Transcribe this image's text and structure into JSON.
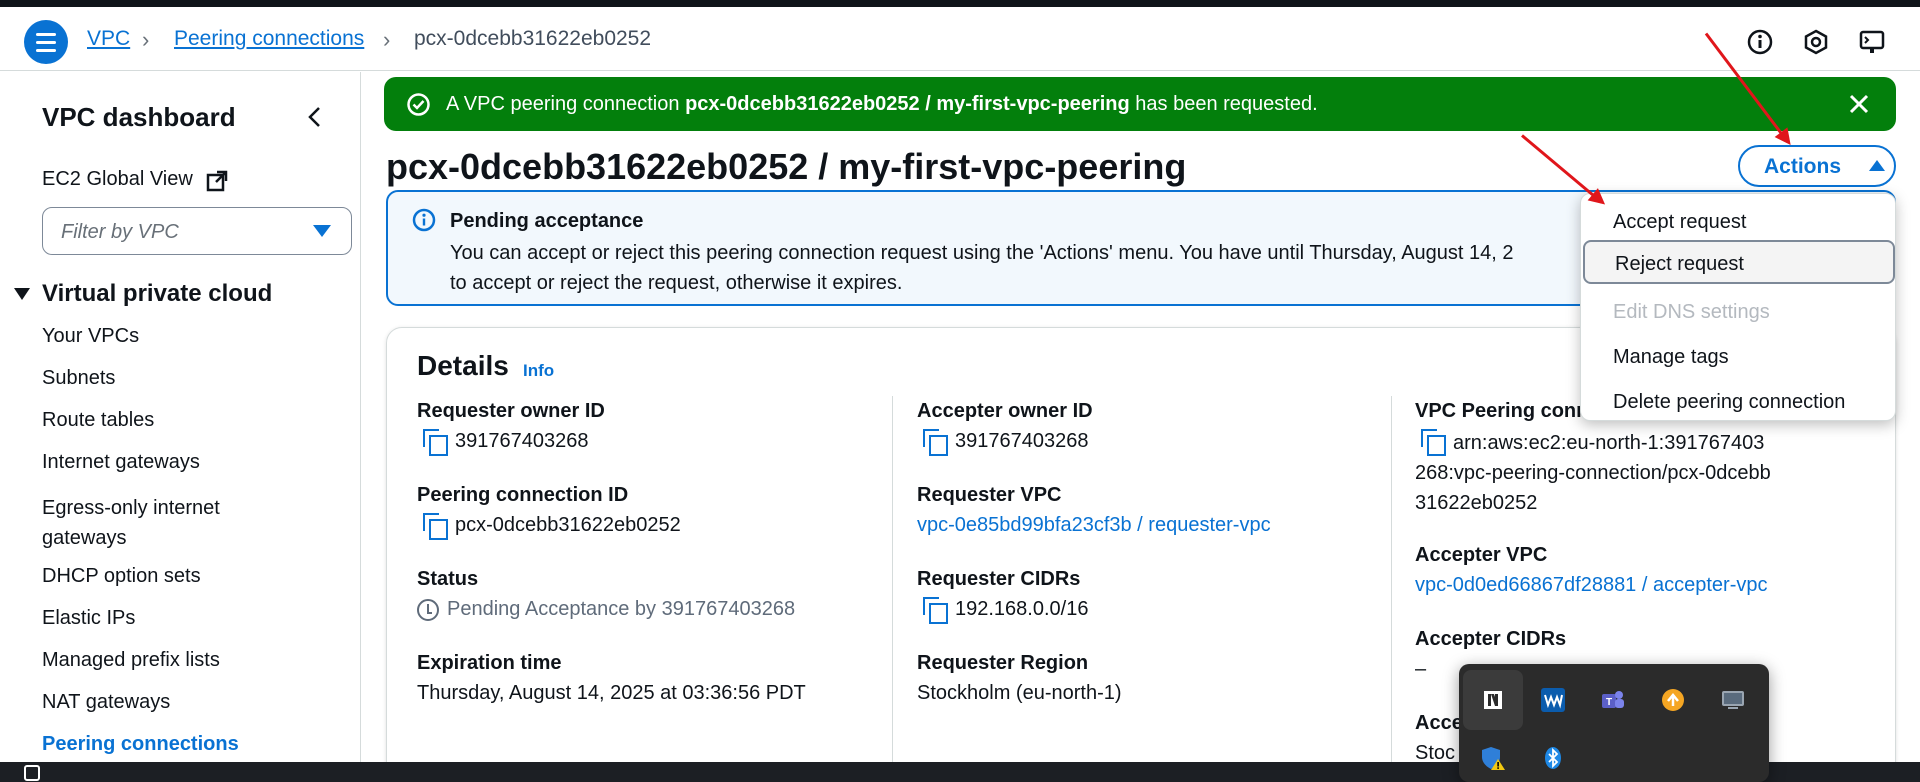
{
  "breadcrumb": {
    "items": [
      "VPC",
      "Peering connections",
      "pcx-0dcebb31622eb0252"
    ]
  },
  "header_icons": [
    "info-icon",
    "settings-icon",
    "console-icon"
  ],
  "sidebar": {
    "title": "VPC dashboard",
    "global_view": "EC2 Global View",
    "filter_placeholder": "Filter by VPC",
    "section": "Virtual private cloud",
    "items": [
      "Your VPCs",
      "Subnets",
      "Route tables",
      "Internet gateways",
      "Egress-only internet gateways",
      "DHCP option sets",
      "Elastic IPs",
      "Managed prefix lists",
      "NAT gateways",
      "Peering connections"
    ]
  },
  "flash": {
    "prefix": "A VPC peering connection",
    "name": "pcx-0dcebb31622eb0252 / my-first-vpc-peering",
    "suffix": "has been requested.",
    "color": "#037f0c"
  },
  "page": {
    "title": "pcx-0dcebb31622eb0252 / my-first-vpc-peering",
    "actions_label": "Actions"
  },
  "alert": {
    "heading": "Pending acceptance",
    "body": "You can accept or reject this peering connection request using the 'Actions' menu. You have until Thursday, August 14, 2",
    "body2": "to accept or reject the request, otherwise it expires."
  },
  "details": {
    "title": "Details",
    "info": "Info",
    "col1": {
      "requester_owner_label": "Requester owner ID",
      "requester_owner": "391767403268",
      "peering_id_label": "Peering connection ID",
      "peering_id": "pcx-0dcebb31622eb0252",
      "status_label": "Status",
      "status": "Pending Acceptance by 391767403268",
      "expiration_label": "Expiration time",
      "expiration": "Thursday, August 14, 2025 at 03:36:56 PDT"
    },
    "col2": {
      "accepter_owner_label": "Accepter owner ID",
      "accepter_owner": "391767403268",
      "requester_vpc_label": "Requester VPC",
      "requester_vpc": "vpc-0e85bd99bfa23cf3b / requester-vpc",
      "requester_cidrs_label": "Requester CIDRs",
      "requester_cidrs": "192.168.0.0/16",
      "requester_region_label": "Requester Region",
      "requester_region": "Stockholm (eu-north-1)"
    },
    "col3": {
      "arn_label": "VPC Peering conn",
      "arn": "arn:aws:ec2:eu-north-1:391767403268:vpc-peering-connection/pcx-0dcebb31622eb0252",
      "accepter_vpc_label": "Accepter VPC",
      "accepter_vpc": "vpc-0d0ed66867df28881 / accepter-vpc",
      "accepter_cidrs_label": "Accepter CIDRs",
      "accepter_cidrs": "–",
      "accepter_region_label": "Acce",
      "accepter_region": "Stoc"
    }
  },
  "actions_menu": {
    "items": [
      "Accept request",
      "Reject request",
      "Edit DNS settings",
      "Manage tags",
      "Delete peering connection"
    ]
  },
  "tray": {
    "icons": [
      "notion-icon",
      "waves-icon",
      "teams-icon",
      "upload-icon",
      "display-icon",
      "defender-warning-icon",
      "bluetooth-icon"
    ]
  },
  "colors": {
    "accent": "#0972d3",
    "success": "#037f0c",
    "annotation": "#e0161b"
  }
}
